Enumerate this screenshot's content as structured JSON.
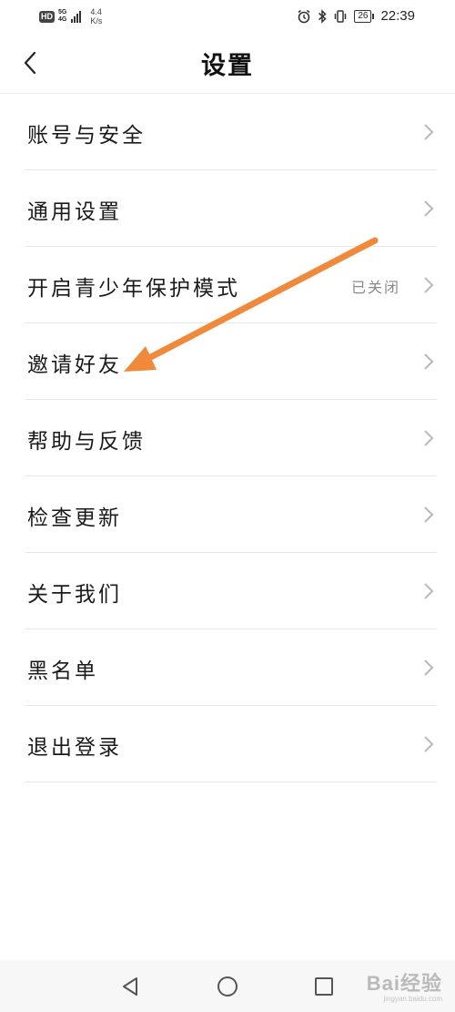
{
  "status_bar": {
    "hd": "HD",
    "network": "5G",
    "network_sub": "4G",
    "speed_value": "4.4",
    "speed_unit": "K/s",
    "battery": "26",
    "time": "22:39",
    "icons": [
      "alarm-icon",
      "bluetooth-icon",
      "vibrate-icon",
      "battery-icon"
    ]
  },
  "header": {
    "title": "设置",
    "back_icon": "chevron-left-icon"
  },
  "settings": {
    "items": [
      {
        "label": "账号与安全",
        "value": ""
      },
      {
        "label": "通用设置",
        "value": ""
      },
      {
        "label": "开启青少年保护模式",
        "value": "已关闭"
      },
      {
        "label": "邀请好友",
        "value": ""
      },
      {
        "label": "帮助与反馈",
        "value": ""
      },
      {
        "label": "检查更新",
        "value": ""
      },
      {
        "label": "关于我们",
        "value": ""
      },
      {
        "label": "黑名单",
        "value": ""
      },
      {
        "label": "退出登录",
        "value": ""
      }
    ]
  },
  "annotation": {
    "arrow_color": "#f0893a"
  },
  "nav_bar": {
    "icons": [
      "back-triangle-icon",
      "home-circle-icon",
      "recents-square-icon"
    ]
  },
  "watermark": {
    "brand": "Bai经验",
    "url": "jingyan.baidu.com"
  }
}
